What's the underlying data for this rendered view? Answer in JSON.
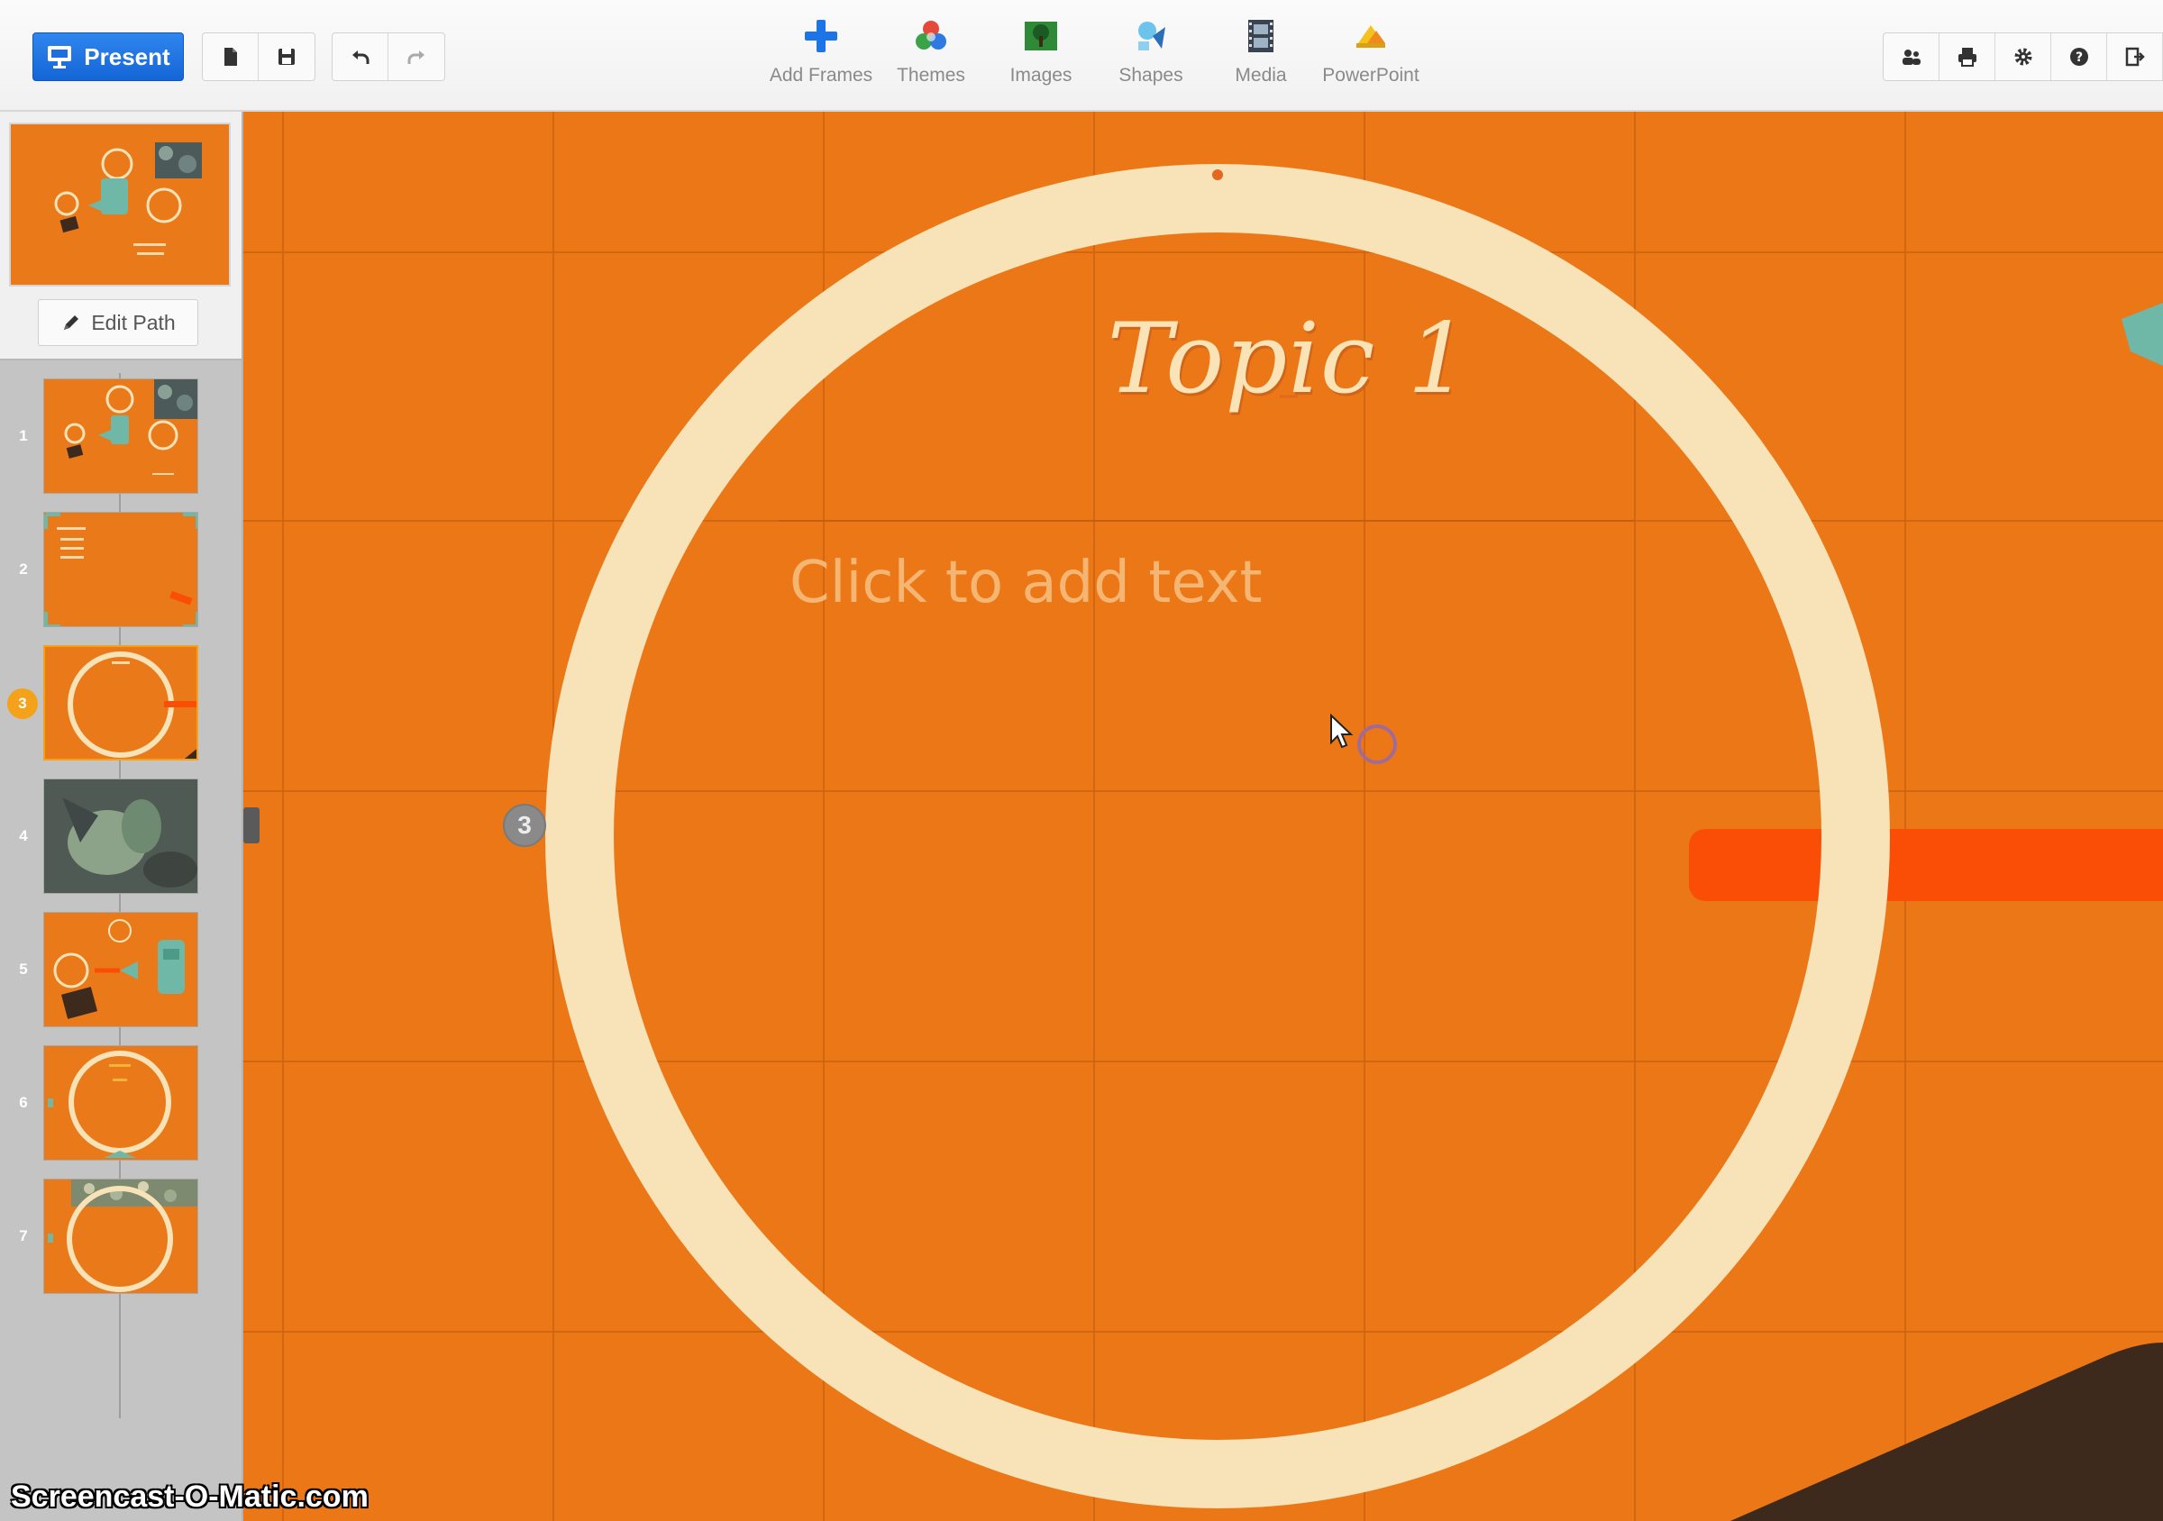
{
  "toolbar": {
    "present_label": "Present",
    "insert_tools": [
      {
        "label": "Add Frames",
        "icon": "plus-icon"
      },
      {
        "label": "Themes",
        "icon": "themes-icon"
      },
      {
        "label": "Images",
        "icon": "image-icon"
      },
      {
        "label": "Shapes",
        "icon": "shapes-icon"
      },
      {
        "label": "Media",
        "icon": "film-icon"
      },
      {
        "label": "PowerPoint",
        "icon": "powerpoint-icon"
      }
    ],
    "file_icons": [
      "new-file-icon",
      "save-icon"
    ],
    "history_icons": [
      "undo-icon",
      "redo-icon"
    ],
    "right_icons": [
      "share-icon",
      "print-icon",
      "settings-icon",
      "help-icon",
      "exit-icon"
    ]
  },
  "sidebar": {
    "edit_path_label": "Edit Path",
    "slides": [
      {
        "number": "1"
      },
      {
        "number": "2",
        "thumb_text": "Content\nTopic 1\nTopic 2\nTopic 3"
      },
      {
        "number": "3",
        "active": true,
        "thumb_text": "Topic 1"
      },
      {
        "number": "4"
      },
      {
        "number": "5"
      },
      {
        "number": "6",
        "thumb_text": "Topic 2"
      },
      {
        "number": "7"
      }
    ]
  },
  "canvas": {
    "title": "Topic 1",
    "body_placeholder": "Click to add text",
    "path_badge": "3"
  },
  "watermark": "Screencast-O-Matic.com",
  "colors": {
    "canvas_bg": "#ec7716",
    "ring": "#f8e3b8",
    "accent_bar": "#fa4e06",
    "dark_shape": "#3d2a1d",
    "teal_shape": "#6fb7a6",
    "present_button": "#1a6fe0"
  }
}
